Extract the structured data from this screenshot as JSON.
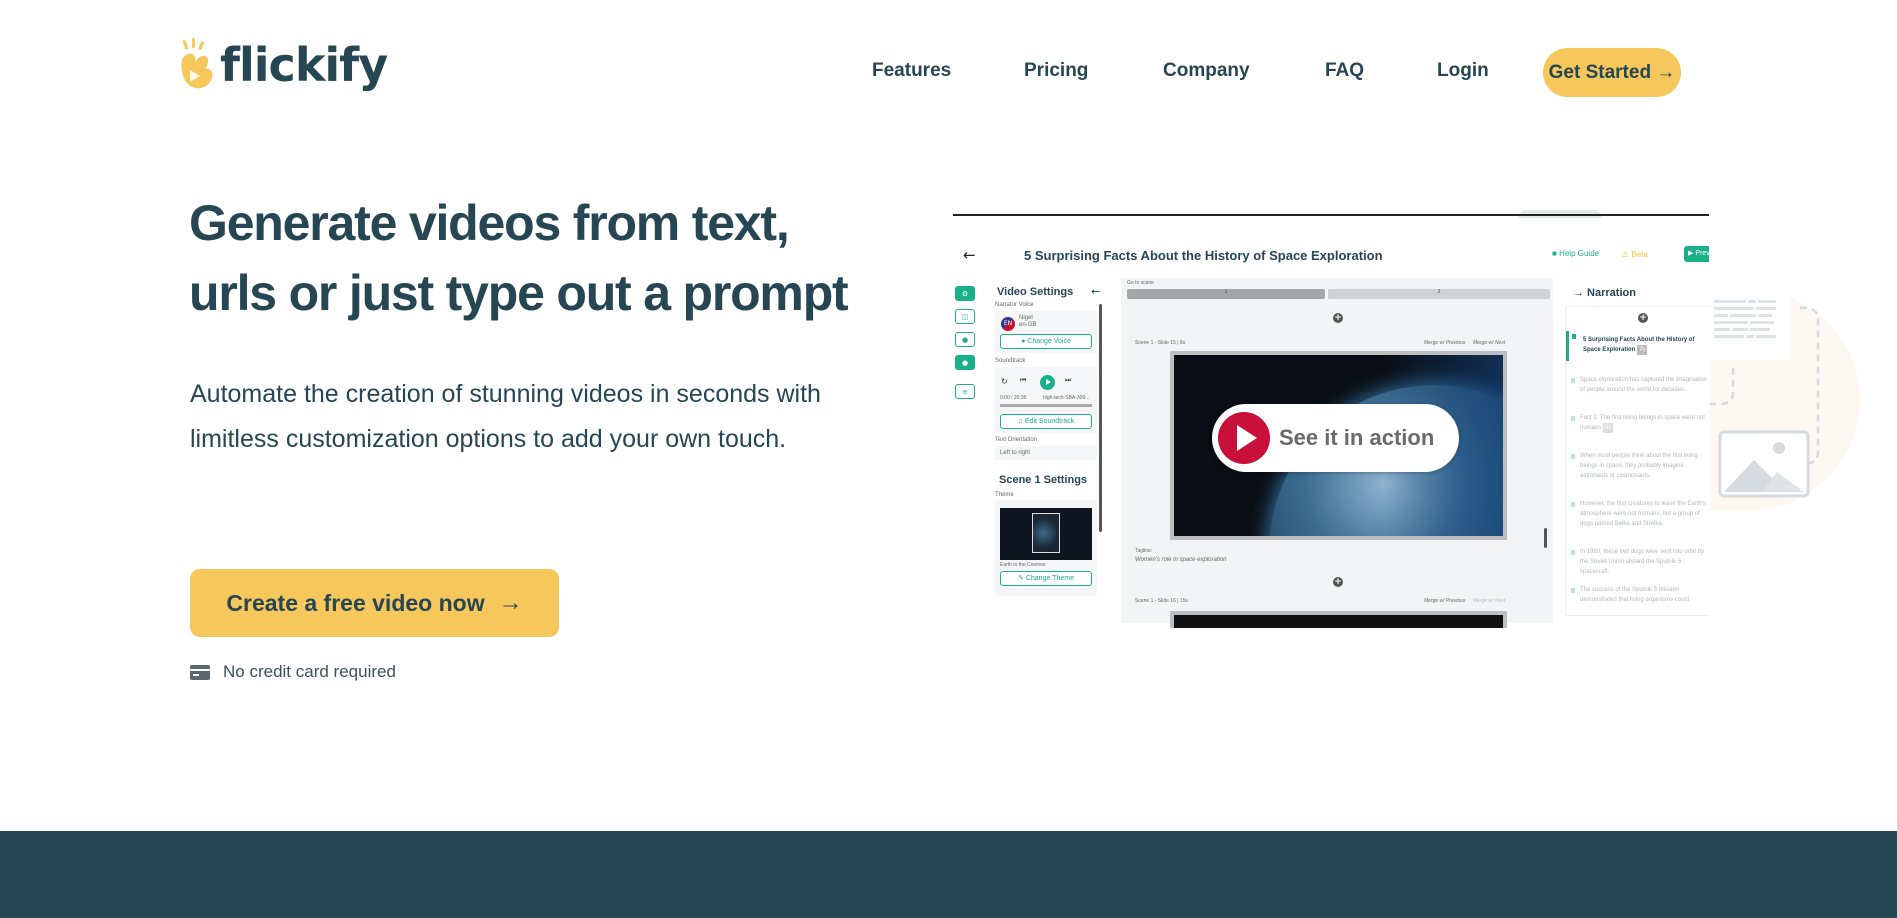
{
  "brand": {
    "name": "flickify",
    "accent": "#f6c75a",
    "dark": "#264653",
    "green": "#1ab188"
  },
  "nav": {
    "items": [
      {
        "label": "Features"
      },
      {
        "label": "Pricing"
      },
      {
        "label": "Company"
      },
      {
        "label": "FAQ"
      },
      {
        "label": "Login"
      }
    ],
    "cta": "Get Started →"
  },
  "hero": {
    "title_line1": "Generate videos from text,",
    "title_line2": "urls or just type out a prompt",
    "subtitle": "Automate the creation of stunning videos in seconds with limitless customization options to add your own touch.",
    "cta_label": "Create a free video now",
    "cta_arrow": "→",
    "note": "No credit card required",
    "note_icon": "credit-card-icon"
  },
  "app_preview": {
    "title": "5 Surprising Facts About the History of Space Exploration",
    "help_guide": "Help Guide",
    "beta": "⚠ Beta",
    "preview_btn": "▶ Prev",
    "video_settings": {
      "title": "Video Settings",
      "narrator_label": "Narrator Voice",
      "voice_code": "EN",
      "voice_name": "Nigel",
      "voice_locale": "en-GB",
      "change_voice": "● Change Voice",
      "soundtrack_label": "Soundtrack",
      "time": "0:00 / 20:35",
      "track": "high-tech-SBA-300...",
      "edit_soundtrack": "♫ Edit Soundtrack",
      "orientation_label": "Text Orientation",
      "orientation_value": "Left to right"
    },
    "scene_settings": {
      "title": "Scene 1 Settings",
      "theme_label": "Theme",
      "theme_name": "Earth in the Cosmos",
      "change_theme": "✎ Change Theme"
    },
    "editor": {
      "go_to_scene": "Go to scene",
      "scene_tabs": [
        "1",
        "2"
      ],
      "slide1_label": "Scene 1 - Slide 15 | 8s",
      "merge_prev": "Merge w/ Previous",
      "merge_next": "Merge w/ Next",
      "see_it_in_action": "See it in action",
      "tagline_label": "Tagline:",
      "tagline_value": "Women's role in space exploration",
      "slide2_label": "Scene 1 - Slide 16 | 15s"
    },
    "narration": {
      "title": "→  Narration",
      "items": [
        {
          "text": "5 Surprising Facts About the History of Space Exploration",
          "badge": "7s",
          "active": true
        },
        {
          "text": "Space exploration has captured the imagination of people around the world for decades."
        },
        {
          "text": "Fact 1: The first living beings in space were not humans",
          "badge": "6s"
        },
        {
          "text": "When most people think about the first living beings in space, they probably imagine astronauts or cosmonauts."
        },
        {
          "text": "However, the first creatures to leave the Earth's atmosphere were not humans, but a group of dogs named Belka and Strelka."
        },
        {
          "text": "In 1960, these two dogs were sent into orbit by the Soviet Union aboard the Sputnik 5 spacecraft."
        },
        {
          "text": "The success of the Sputnik 5 mission demonstrated that living organisms could"
        }
      ]
    }
  }
}
